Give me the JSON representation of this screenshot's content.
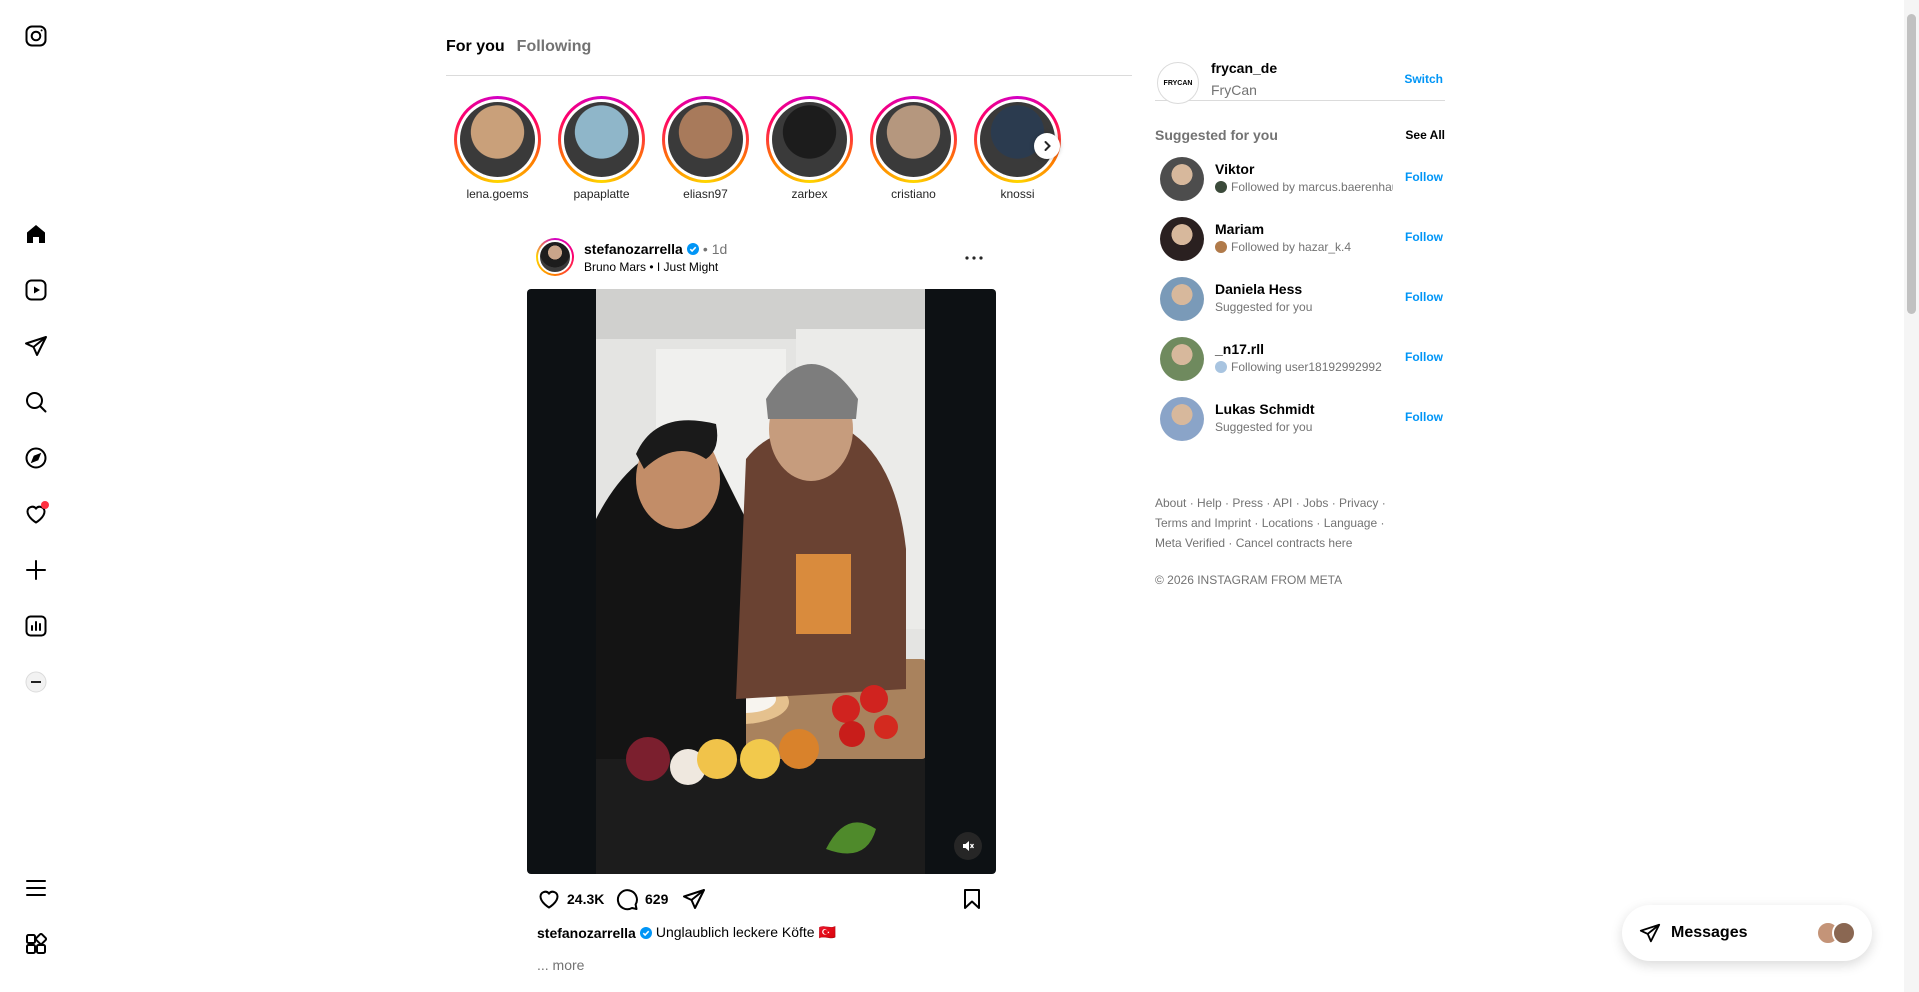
{
  "nav": {
    "items": [
      {
        "name": "instagram-logo-icon"
      },
      {
        "name": "home-icon"
      },
      {
        "name": "reels-icon"
      },
      {
        "name": "direct-messages-icon"
      },
      {
        "name": "search-icon"
      },
      {
        "name": "explore-icon"
      },
      {
        "name": "notifications-heart-icon"
      },
      {
        "name": "create-plus-icon"
      },
      {
        "name": "dashboard-icon"
      },
      {
        "name": "profile-avatar-icon"
      },
      {
        "name": "menu-icon"
      },
      {
        "name": "also-from-meta-icon"
      }
    ],
    "notification_dot_color": "#ff3040"
  },
  "feed": {
    "tabs": [
      {
        "label": "For you",
        "active": true
      },
      {
        "label": "Following",
        "active": false
      }
    ]
  },
  "stories": [
    {
      "username": "lena.goems",
      "color": "#c9a07a"
    },
    {
      "username": "papaplatte",
      "color": "#8fb6c9"
    },
    {
      "username": "eliasn97",
      "color": "#a87a5b"
    },
    {
      "username": "zarbex",
      "color": "#1c1c1c"
    },
    {
      "username": "cristiano",
      "color": "#b5977e"
    },
    {
      "username": "knossi",
      "color": "#2b3b4f"
    }
  ],
  "post": {
    "username": "stefanozarrella",
    "verified": true,
    "separator": "•",
    "time": "1d",
    "audio": "Bruno Mars • I Just Might",
    "likes": "24.3K",
    "comments": "629",
    "caption_username": "stefanozarrella",
    "caption_text": "Unglaublich leckere Köfte 🇹🇷",
    "more_label": "... more"
  },
  "account": {
    "username": "frycan_de",
    "display_name": "FryCan",
    "logo_text": "FRYCAN",
    "switch_label": "Switch"
  },
  "suggestions": {
    "title": "Suggested for you",
    "see_all": "See All",
    "follow_label": "Follow",
    "items": [
      {
        "name": "Viktor",
        "sub": "Followed by marcus.baerenhaus",
        "mini": "#3b4a3a",
        "avatar": "#4d4d4d"
      },
      {
        "name": "Mariam",
        "sub": "Followed by hazar_k.4",
        "mini": "#b07a4a",
        "avatar": "#2a2020"
      },
      {
        "name": "Daniela Hess",
        "sub": "Suggested for you",
        "mini": "",
        "avatar": "#7a9ab8"
      },
      {
        "name": "_n17.rll",
        "sub": "Following user18192992992",
        "mini": "#a8c4e0",
        "avatar": "#6f8a5e"
      },
      {
        "name": "Lukas Schmidt",
        "sub": "Suggested for you",
        "mini": "",
        "avatar": "#8aa4c8"
      }
    ]
  },
  "footer": {
    "line1": "About · Help · Press · API · Jobs · Privacy ·",
    "line2": "Terms and Imprint · Locations · Language ·",
    "line3": "Meta Verified · Cancel contracts here",
    "copyright": "© 2026 INSTAGRAM FROM META"
  },
  "messages": {
    "label": "Messages"
  },
  "colors": {
    "link": "#0095f6",
    "muted": "#737373",
    "border": "#dbdbdb"
  }
}
